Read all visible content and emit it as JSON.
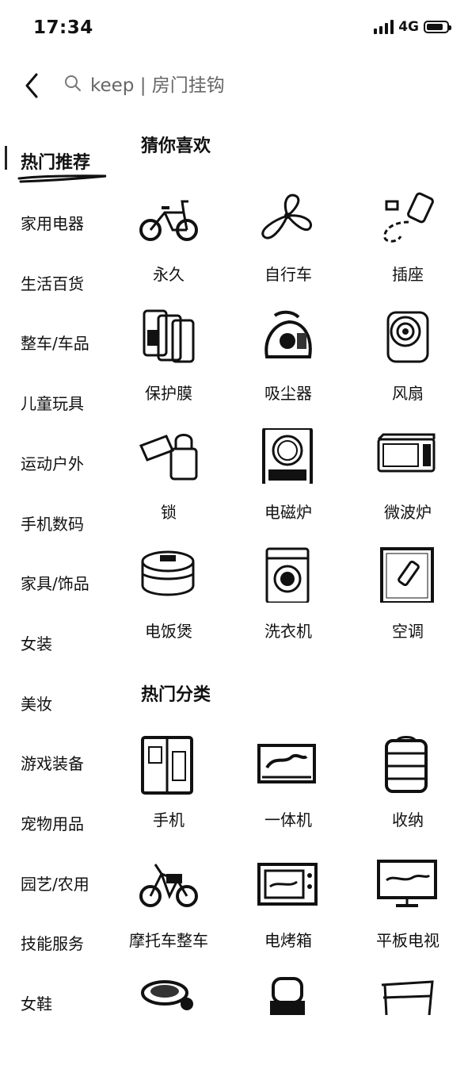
{
  "status_bar": {
    "time": "17:34",
    "network": "4G",
    "battery_level": 0.85
  },
  "search": {
    "query_text": "keep | 房门挂钩"
  },
  "sidebar": {
    "items": [
      {
        "label": "热门推荐",
        "active": true
      },
      {
        "label": "家用电器"
      },
      {
        "label": "生活百货"
      },
      {
        "label": "整车/车品"
      },
      {
        "label": "儿童玩具"
      },
      {
        "label": "运动户外"
      },
      {
        "label": "手机数码"
      },
      {
        "label": "家具/饰品"
      },
      {
        "label": "女装"
      },
      {
        "label": "美妆"
      },
      {
        "label": "游戏装备"
      },
      {
        "label": "宠物用品"
      },
      {
        "label": "园艺/农用"
      },
      {
        "label": "技能服务"
      },
      {
        "label": "女鞋"
      }
    ]
  },
  "guess_section": {
    "title": "猜你喜欢",
    "items": [
      {
        "label": "永久",
        "icon": "bicycle-icon"
      },
      {
        "label": "自行车",
        "icon": "fan-blade-icon"
      },
      {
        "label": "插座",
        "icon": "power-strip-icon"
      },
      {
        "label": "保护膜",
        "icon": "screen-protector-icon"
      },
      {
        "label": "吸尘器",
        "icon": "vacuum-cleaner-icon"
      },
      {
        "label": "风扇",
        "icon": "fan-icon"
      },
      {
        "label": "锁",
        "icon": "lock-icon"
      },
      {
        "label": "电磁炉",
        "icon": "induction-cooker-icon"
      },
      {
        "label": "微波炉",
        "icon": "microwave-icon"
      },
      {
        "label": "电饭煲",
        "icon": "rice-cooker-icon"
      },
      {
        "label": "洗衣机",
        "icon": "washing-machine-icon"
      },
      {
        "label": "空调",
        "icon": "air-conditioner-icon"
      }
    ]
  },
  "hot_section": {
    "title": "热门分类",
    "items": [
      {
        "label": "手机",
        "icon": "phone-icon"
      },
      {
        "label": "一体机",
        "icon": "all-in-one-pc-icon"
      },
      {
        "label": "收纳",
        "icon": "storage-icon"
      },
      {
        "label": "摩托车整车",
        "icon": "motorcycle-icon"
      },
      {
        "label": "电烤箱",
        "icon": "oven-icon"
      },
      {
        "label": "平板电视",
        "icon": "tv-icon"
      },
      {
        "label": "",
        "icon": "pet-bed-icon"
      },
      {
        "label": "",
        "icon": "water-dispenser-icon"
      },
      {
        "label": "",
        "icon": "rack-icon"
      }
    ]
  }
}
